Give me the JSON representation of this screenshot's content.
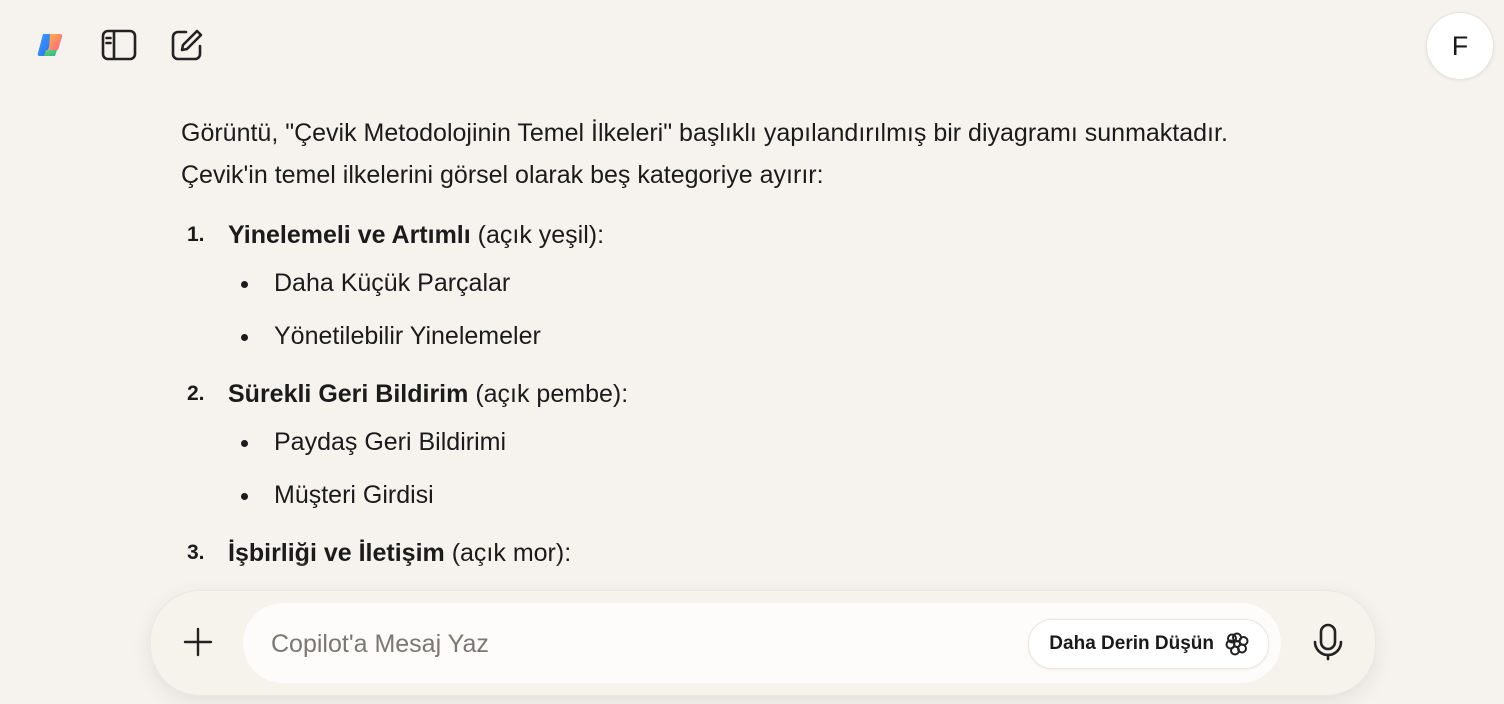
{
  "user": {
    "avatar_initial": "F"
  },
  "toolbar": {
    "icons": [
      "copilot-logo-icon",
      "sidebar-toggle-icon",
      "new-chat-icon"
    ]
  },
  "message": {
    "intro": "Görüntü, \"Çevik Metodolojinin Temel İlkeleri\" başlıklı yapılandırılmış bir diyagramı sunmaktadır. Çevik'in temel ilkelerini görsel olarak beş kategoriye ayırır:",
    "items": [
      {
        "number": "1.",
        "name": "Yinelemeli ve Artımlı",
        "color_note": "(açık yeşil):",
        "subitems": [
          "Daha Küçük Parçalar",
          "Yönetilebilir Yinelemeler"
        ]
      },
      {
        "number": "2.",
        "name": "Sürekli Geri Bildirim",
        "color_note": "(açık pembe):",
        "subitems": [
          "Paydaş Geri Bildirimi",
          "Müşteri Girdisi"
        ]
      },
      {
        "number": "3.",
        "name": "İşbirliği ve İletişim",
        "color_note": "(açık mor):",
        "subitems": []
      }
    ]
  },
  "composer": {
    "placeholder": "Copilot'a Mesaj Yaz",
    "think_label": "Daha Derin Düşün"
  },
  "colors": {
    "background": "#f6f3ef",
    "text": "#1b1b1b",
    "placeholder": "#7b7772"
  }
}
